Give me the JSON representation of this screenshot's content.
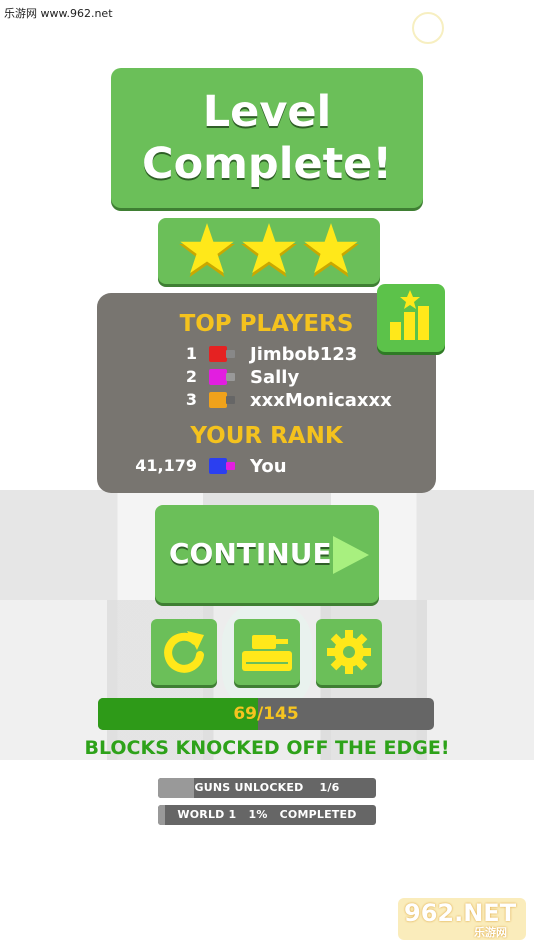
{
  "watermark": {
    "top_text": "乐游网 www.962.net",
    "logo_main": "962.NET",
    "logo_sub": "乐游网"
  },
  "title": {
    "line1": "Level",
    "line2": "Complete!"
  },
  "stars": {
    "earned": 3,
    "total": 3,
    "color": "#ffe81a"
  },
  "leaderboard": {
    "header": "TOP PLAYERS",
    "players": [
      {
        "rank": "1",
        "name": "Jimbob123",
        "color": "#e52222"
      },
      {
        "rank": "2",
        "name": "Sally",
        "color": "#e21ee0"
      },
      {
        "rank": "3",
        "name": "xxxMonicaxxx",
        "color": "#f0a21b"
      }
    ],
    "your_rank_header": "YOUR RANK",
    "you": {
      "rank": "41,179",
      "name": "You",
      "color": "#2b3ff0",
      "gun_color": "#e21ee0"
    }
  },
  "buttons": {
    "continue_label": "CONTINUE",
    "leaderboard_icon": "leaderboard-chart-icon",
    "restart_icon": "restart-icon",
    "tank_icon": "tank-icon",
    "settings_icon": "gear-icon"
  },
  "progress": {
    "text": "69/145",
    "current": 69,
    "total": 145,
    "caption": "BLOCKS KNOCKED OFF THE EDGE!"
  },
  "guns": {
    "text": "GUNS UNLOCKED    1/6",
    "fraction": 0.1667
  },
  "world": {
    "text": "WORLD 1   1%   COMPLETED",
    "fraction": 0.01
  }
}
